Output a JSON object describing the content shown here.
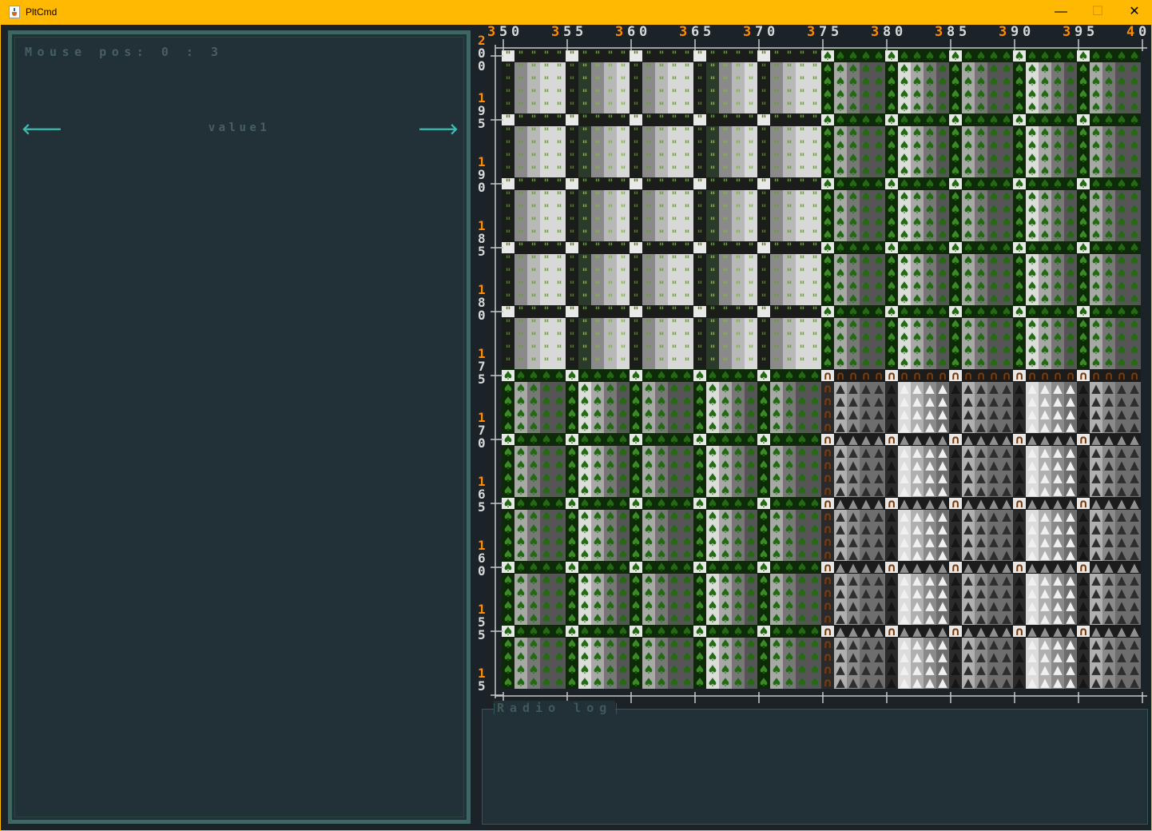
{
  "window": {
    "title": "PltCmd",
    "controls": {
      "minimize": "—",
      "maximize": "☐",
      "close": "✕"
    },
    "frame_color": "#ffb900"
  },
  "left_panel": {
    "mouse_pos": "Mouse pos: 0 : 3",
    "value_label": "value1",
    "left_arrow": "🡐",
    "right_arrow": "🡒"
  },
  "map": {
    "x_labels": [
      "350",
      "355",
      "360",
      "365",
      "370",
      "375",
      "380",
      "385",
      "390",
      "395",
      "40"
    ],
    "y_labels": [
      [
        "2",
        "0",
        "0"
      ],
      [
        "1",
        "9",
        "5"
      ],
      [
        "1",
        "9",
        "0"
      ],
      [
        "1",
        "8",
        "5"
      ],
      [
        "1",
        "8",
        "0"
      ],
      [
        "1",
        "7",
        "5"
      ],
      [
        "1",
        "7",
        "0"
      ],
      [
        "1",
        "6",
        "5"
      ],
      [
        "1",
        "6",
        "0"
      ],
      [
        "1",
        "5",
        "5"
      ],
      [
        "1",
        "5"
      ]
    ],
    "terrain_grid": [
      [
        "grass",
        "grass",
        "grass",
        "grass",
        "grass",
        "forest",
        "forest",
        "forest",
        "forest",
        "forest"
      ],
      [
        "grass",
        "grass",
        "grass",
        "grass",
        "grass",
        "forest",
        "forest",
        "forest",
        "forest",
        "forest"
      ],
      [
        "grass",
        "grass",
        "grass",
        "grass",
        "grass",
        "forest",
        "forest",
        "forest",
        "forest",
        "forest"
      ],
      [
        "grass",
        "grass",
        "grass",
        "grass",
        "grass",
        "forest",
        "forest",
        "forest",
        "forest",
        "forest"
      ],
      [
        "grass",
        "grass",
        "grass",
        "grass",
        "grass",
        "forest",
        "forest",
        "forest",
        "forest",
        "forest"
      ],
      [
        "forest",
        "forest",
        "forest",
        "forest",
        "forest",
        "mountain",
        "mountain",
        "mountain",
        "mountain",
        "mountain"
      ],
      [
        "forest",
        "forest",
        "forest",
        "forest",
        "forest",
        "mountain",
        "mountain",
        "mountain",
        "mountain",
        "mountain"
      ],
      [
        "forest",
        "forest",
        "forest",
        "forest",
        "forest",
        "mountain",
        "mountain",
        "mountain",
        "mountain",
        "mountain"
      ],
      [
        "forest",
        "forest",
        "forest",
        "forest",
        "forest",
        "mountain",
        "mountain",
        "mountain",
        "mountain",
        "mountain"
      ],
      [
        "forest",
        "forest",
        "forest",
        "forest",
        "forest",
        "mountain",
        "mountain",
        "mountain",
        "mountain",
        "mountain"
      ]
    ],
    "glyphs": {
      "grass": "\"",
      "forest": "♠",
      "mountain": "▲",
      "hill": "∩"
    },
    "colors": {
      "label_orange": "#ff8c00",
      "label_gray": "#d8d8d8",
      "grass_fg": "#6a9a3c",
      "forest_fg": "#236a12",
      "forest_bg": "#236a12",
      "mountain_fg": "#3a3a3a",
      "hill_fg": "#7a3a08",
      "band_dark": "#1a1d1a",
      "axis_line": "#c8c8c8"
    }
  },
  "radio_log": {
    "title": "Radio log"
  }
}
